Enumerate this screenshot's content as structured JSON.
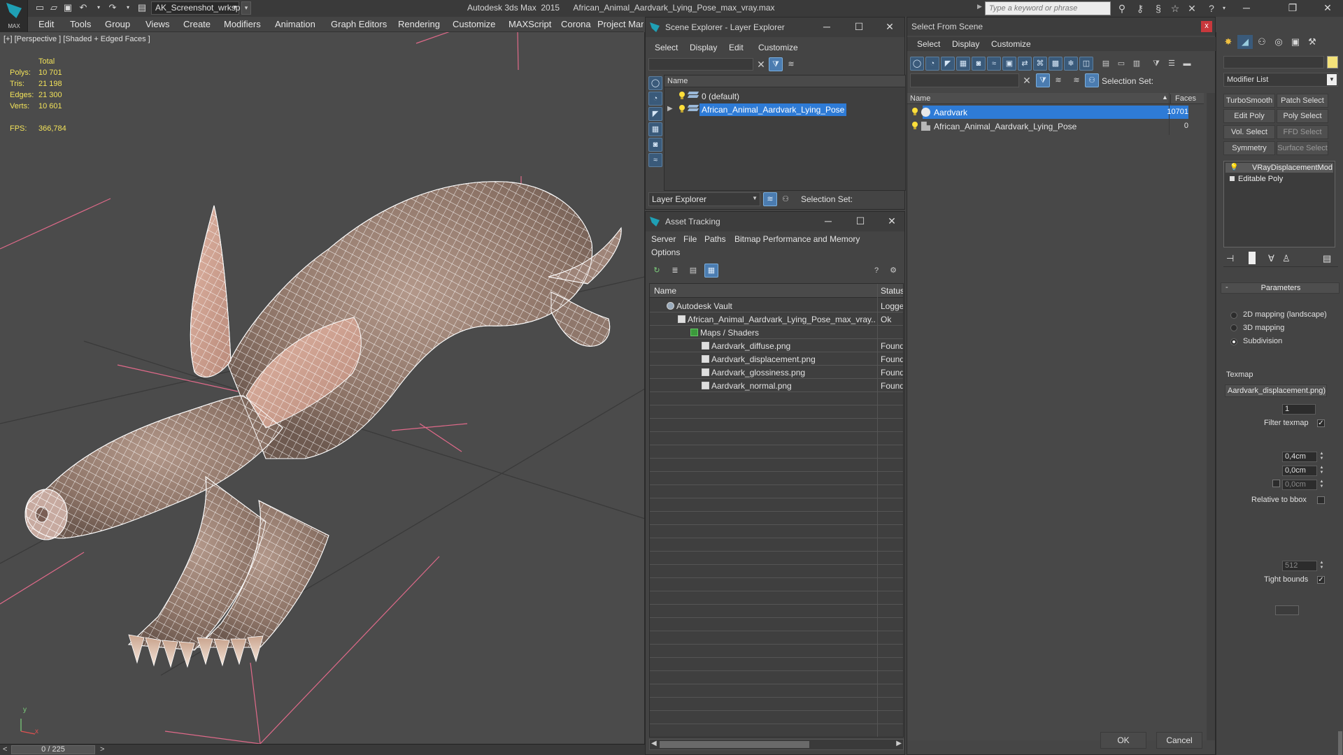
{
  "app": {
    "logo_text": "MAX",
    "workspace": "AK_Screenshot_wrksp",
    "title": "Autodesk 3ds Max  2015      African_Animal_Aardvark_Lying_Pose_max_vray.max",
    "search_placeholder": "Type a keyword or phrase"
  },
  "menu": [
    "Edit",
    "Tools",
    "Group",
    "Views",
    "Create",
    "Modifiers",
    "Animation",
    "Graph Editors",
    "Rendering",
    "Customize",
    "MAXScript",
    "Corona",
    "Project Man"
  ],
  "viewport": {
    "label": "[+] [Perspective ] [Shaded + Edged Faces ]",
    "stats": {
      "header": "Total",
      "polys_label": "Polys:",
      "polys": "10 701",
      "tris_label": "Tris:",
      "tris": "21 198",
      "edges_label": "Edges:",
      "edges": "21 300",
      "verts_label": "Verts:",
      "verts": "10 601",
      "fps_label": "FPS:",
      "fps": "366,784"
    },
    "axis_x": "x",
    "axis_y": "y"
  },
  "timeline": {
    "frame": "0 / 225",
    "prev": "<",
    "next": ">"
  },
  "scene_explorer": {
    "title": "Scene Explorer - Layer Explorer",
    "menu": [
      "Select",
      "Display",
      "Edit",
      "Customize"
    ],
    "column_name": "Name",
    "rows": [
      {
        "label": "0 (default)",
        "selected": false
      },
      {
        "label": "African_Animal_Aardvark_Lying_Pose",
        "selected": true
      }
    ],
    "explorer_dropdown": "Layer Explorer",
    "selection_set_label": "Selection Set:"
  },
  "asset_tracking": {
    "title": "Asset Tracking",
    "menu": [
      "Server",
      "File",
      "Paths",
      "Bitmap Performance and Memory"
    ],
    "menu_options": "Options",
    "columns": [
      "Name",
      "Status"
    ],
    "rows": [
      {
        "name": "Autodesk Vault",
        "status": "Logged",
        "indent": 0,
        "icon": "vault-icon"
      },
      {
        "name": "African_Animal_Aardvark_Lying_Pose_max_vray....",
        "status": "Ok",
        "indent": 1,
        "icon": "max-file-icon"
      },
      {
        "name": "Maps / Shaders",
        "status": "",
        "indent": 2,
        "icon": "maps-folder-icon"
      },
      {
        "name": "Aardvark_diffuse.png",
        "status": "Found",
        "indent": 3,
        "icon": "image-file-icon"
      },
      {
        "name": "Aardvark_displacement.png",
        "status": "Found",
        "indent": 3,
        "icon": "image-file-icon"
      },
      {
        "name": "Aardvark_glossiness.png",
        "status": "Found",
        "indent": 3,
        "icon": "image-file-icon"
      },
      {
        "name": "Aardvark_normal.png",
        "status": "Found",
        "indent": 3,
        "icon": "image-file-icon"
      }
    ]
  },
  "select_from_scene": {
    "title": "Select From Scene",
    "close": "x",
    "menu": [
      "Select",
      "Display",
      "Customize"
    ],
    "selection_set_label": "Selection Set:",
    "columns": {
      "name": "Name",
      "faces": "Faces"
    },
    "rows": [
      {
        "name": "Aardvark",
        "faces": "10701",
        "selected": true
      },
      {
        "name": "African_Animal_Aardvark_Lying_Pose",
        "faces": "0",
        "selected": false
      }
    ],
    "ok": "OK",
    "cancel": "Cancel"
  },
  "command_panel": {
    "modifier_list": "Modifier List",
    "buttons": [
      "TurboSmooth",
      "Patch Select",
      "Edit Poly",
      "Poly Select",
      "Vol. Select",
      "FFD Select",
      "Symmetry",
      "Surface Select"
    ],
    "stack": [
      "VRayDisplacementMod",
      "Editable Poly"
    ],
    "parameters_title": "Parameters",
    "rollout_toggle": "-",
    "mapping": [
      {
        "label": "2D mapping (landscape)",
        "checked": false
      },
      {
        "label": "3D mapping",
        "checked": false
      },
      {
        "label": "Subdivision",
        "checked": true
      }
    ],
    "texmap_label": "Texmap",
    "texmap_value": "Aardvark_displacement.png)",
    "spinner_1": "1",
    "filter_texmap": "Filter texmap",
    "amount": "0,4cm",
    "shift": "0,0cm",
    "water_level": "0,0cm",
    "relative_to_bbox": "Relative to bbox",
    "resolution": "512",
    "tight_bounds": "Tight bounds"
  },
  "colors": {
    "selection_blue": "#2e7bd6",
    "stats_yellow": "#f2e25a",
    "wire_white": "#ffffff",
    "grid_pink": "#e06a8a"
  }
}
